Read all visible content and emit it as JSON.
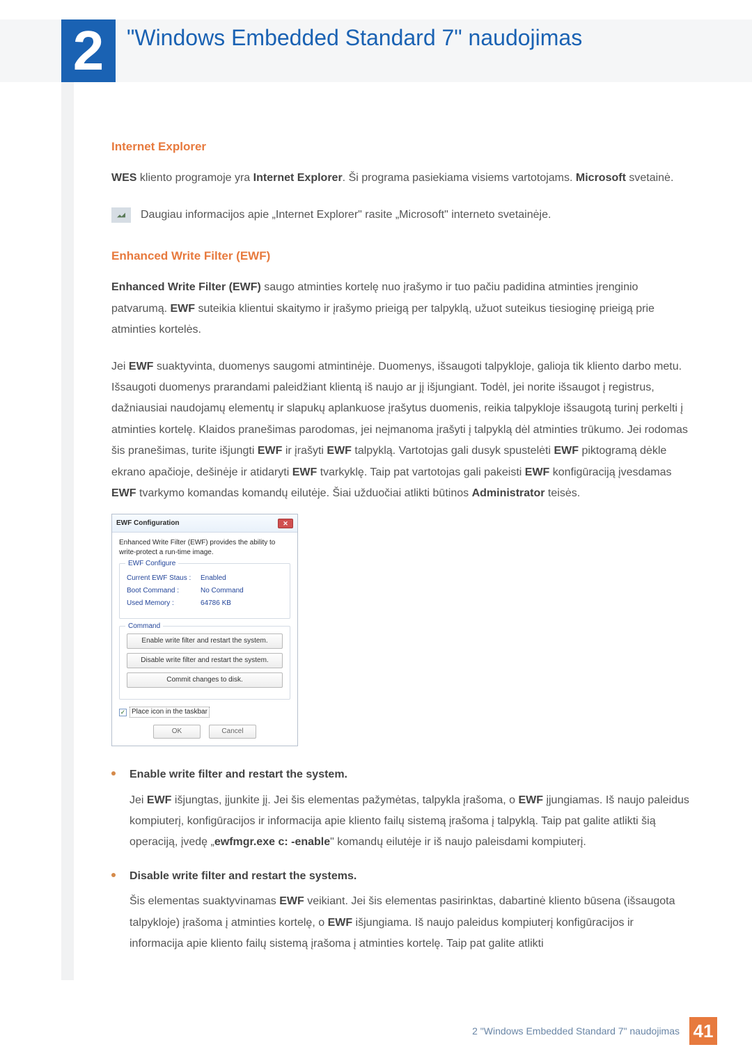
{
  "chapter": {
    "num": "2",
    "title": "\"Windows Embedded Standard 7\" naudojimas"
  },
  "sec_ie": {
    "heading": "Internet Explorer",
    "p1_a": "WES",
    "p1_b": " kliento programoje yra ",
    "p1_c": "Internet Explorer",
    "p1_d": ". Ši programa pasiekiama visiems vartotojams. ",
    "p1_e": "Microsoft",
    "p1_f": " svetainė.",
    "note": "Daugiau informacijos apie „Internet Explorer\" rasite „Microsoft\" interneto svetainėje."
  },
  "sec_ewf": {
    "heading": "Enhanced Write Filter (EWF)",
    "p1_a": "Enhanced Write Filter (EWF)",
    "p1_b": " saugo atminties kortelę nuo įrašymo ir tuo pačiu padidina atminties įrenginio patvarumą. ",
    "p1_c": "EWF",
    "p1_d": " suteikia klientui skaitymo ir įrašymo prieigą per talpyklą, užuot suteikus tiesioginę prieigą prie atminties kortelės.",
    "p2_a": "Jei ",
    "p2_b": "EWF",
    "p2_c": " suaktyvinta, duomenys saugomi atmintinėje. Duomenys, išsaugoti talpykloje, galioja tik kliento darbo metu. Išsaugoti duomenys prarandami paleidžiant klientą iš naujo ar jį išjungiant. Todėl, jei norite išsaugot į registrus, dažniausiai naudojamų elementų ir slapukų aplankuose įrašytus duomenis, reikia talpykloje išsaugotą turinį perkelti į atminties kortelę. Klaidos pranešimas parodomas, jei neįmanoma įrašyti į talpyklą dėl atminties trūkumo. Jei rodomas šis pranešimas, turite išjungti ",
    "p2_d": "EWF",
    "p2_e": " ir įrašyti ",
    "p2_f": "EWF",
    "p2_g": " talpyklą. Vartotojas gali dusyk spustelėti ",
    "p2_h": "EWF",
    "p2_i": " piktogramą dėkle ekrano apačioje, dešinėje ir atidaryti ",
    "p2_j": "EWF",
    "p2_k": " tvarkyklę. Taip pat vartotojas gali pakeisti ",
    "p2_l": "EWF",
    "p2_m": " konfigūraciją įvesdamas ",
    "p2_n": "EWF",
    "p2_o": " tvarkymo komandas komandų eilutėje. Šiai užduočiai atlikti būtinos ",
    "p2_p": "Administrator",
    "p2_q": " teisės."
  },
  "dialog": {
    "title": "EWF Configuration",
    "desc": "Enhanced Write Filter (EWF) provides the ability to write-protect a run-time image.",
    "fs_conf": "EWF Configure",
    "k_status": "Current EWF Staus :",
    "v_status": "Enabled",
    "k_boot": "Boot Command :",
    "v_boot": "No Command",
    "k_mem": "Used Memory :",
    "v_mem": "64786 KB",
    "fs_cmd": "Command",
    "btn_enable": "Enable write filter and restart the system.",
    "btn_disable": "Disable write filter and restart the system.",
    "btn_commit": "Commit changes to disk.",
    "chk_label": "Place icon in the taskbar",
    "ok": "OK",
    "cancel": "Cancel"
  },
  "bullets": {
    "b1_head": "Enable write filter and restart the system.",
    "b1_a": "Jei ",
    "b1_b": "EWF",
    "b1_c": " išjungtas, įjunkite jį. Jei šis elementas pažymėtas, talpykla įrašoma, o ",
    "b1_d": "EWF",
    "b1_e": " įjungiamas. Iš naujo paleidus kompiuterį, konfigūracijos ir informacija apie kliento failų sistemą įrašoma į talpyklą. Taip pat galite atlikti šią operaciją, įvedę „",
    "b1_f": "ewfmgr.exe c: -enable",
    "b1_g": "\" komandų eilutėje ir iš naujo paleisdami kompiuterį.",
    "b2_head": "Disable write filter and restart the systems.",
    "b2_a": "Šis elementas suaktyvinamas ",
    "b2_b": "EWF",
    "b2_c": " veikiant. Jei šis elementas pasirinktas, dabartinė kliento būsena (išsaugota talpykloje) įrašoma į atminties kortelę, o ",
    "b2_d": "EWF",
    "b2_e": " išjungiama. Iš naujo paleidus kompiuterį konfigūracijos ir informacija apie kliento failų sistemą įrašoma į atminties kortelę. Taip pat galite atlikti"
  },
  "footer": {
    "text": "2 \"Windows Embedded Standard 7\" naudojimas",
    "page": "41"
  }
}
